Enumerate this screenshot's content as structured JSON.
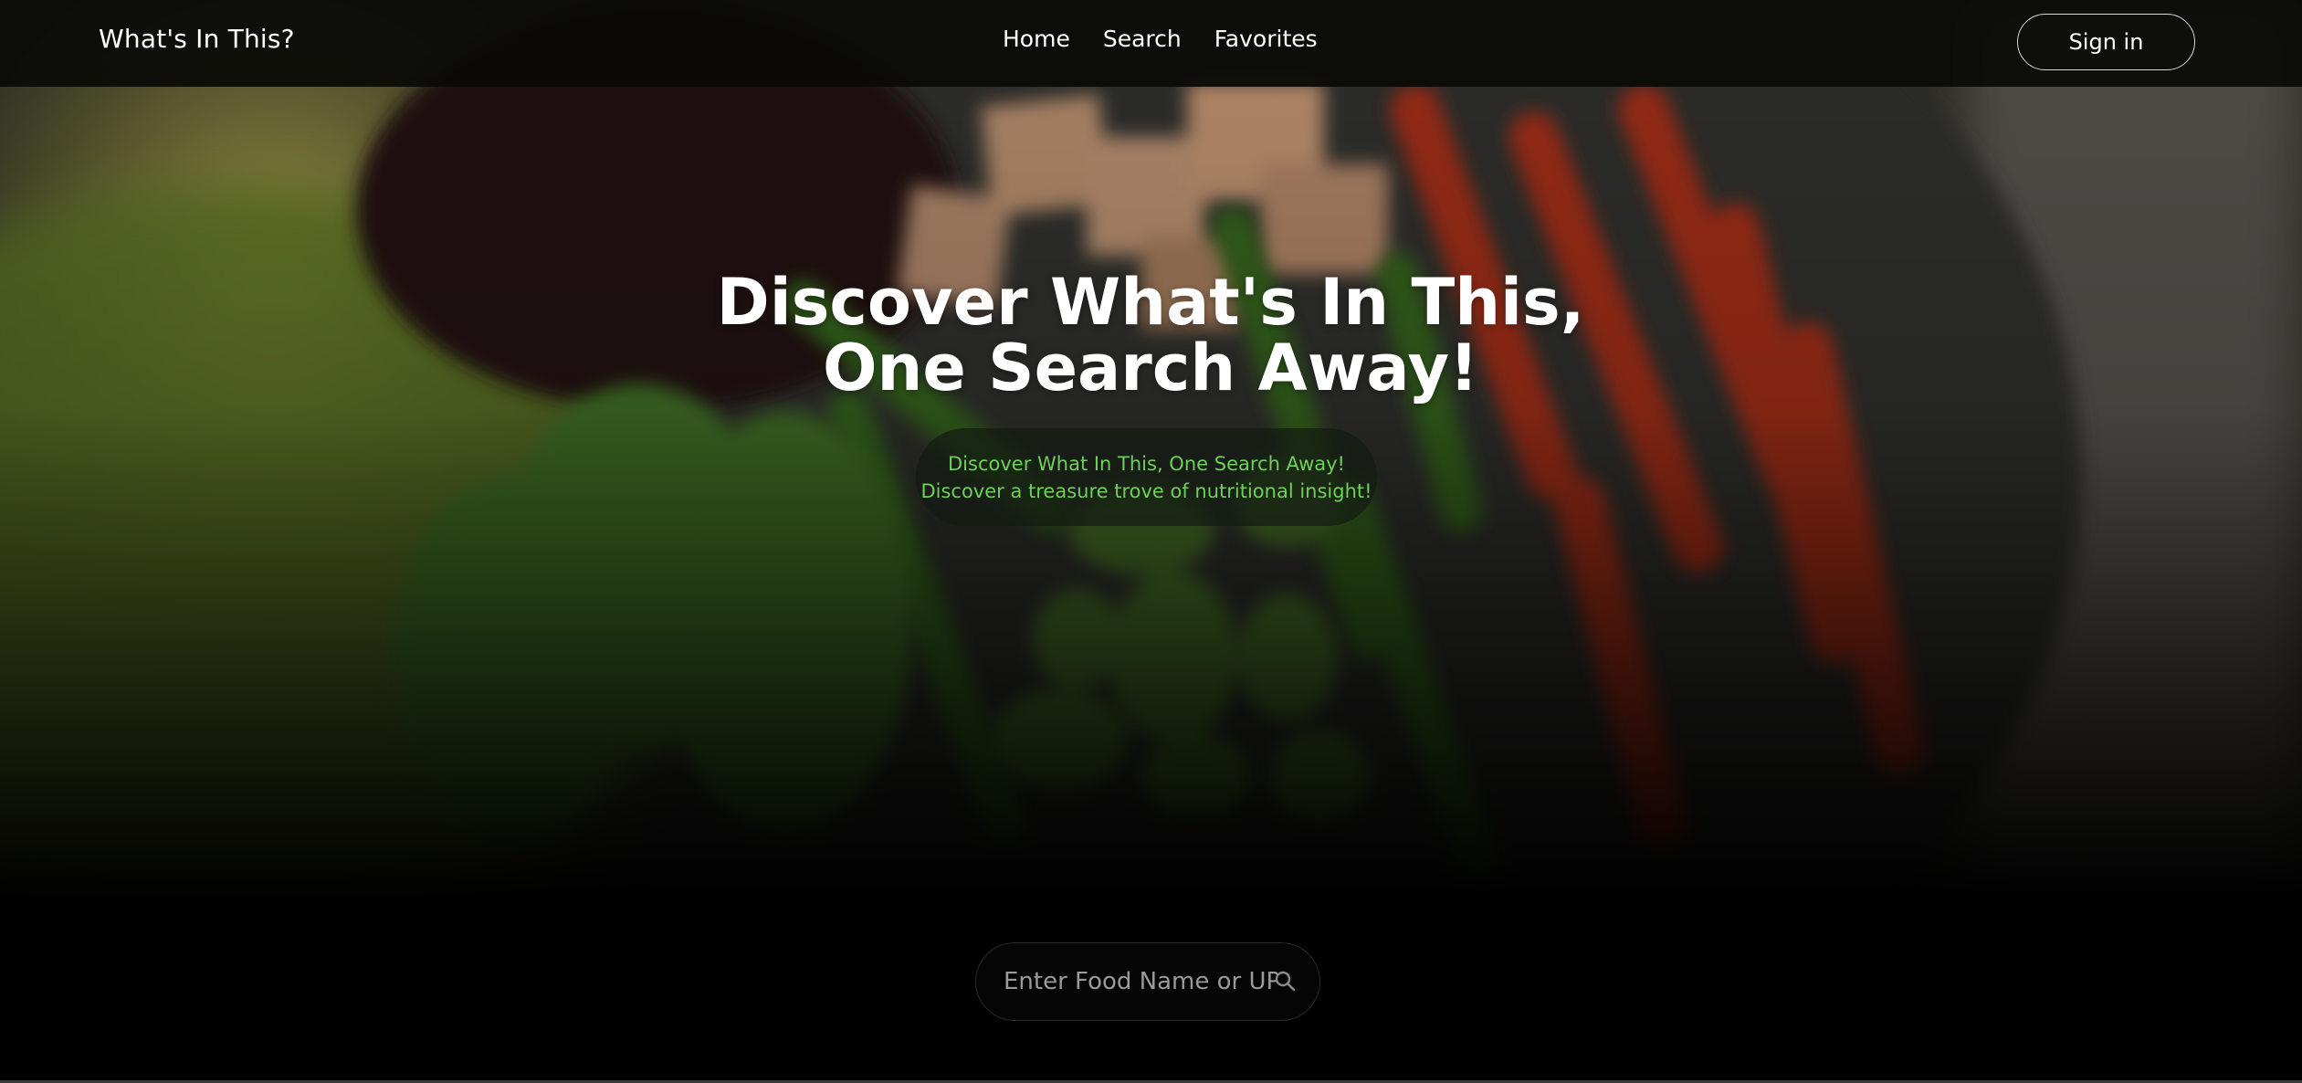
{
  "navbar": {
    "brand": "What's In This?",
    "links": [
      {
        "label": "Home"
      },
      {
        "label": "Search"
      },
      {
        "label": "Favorites"
      }
    ],
    "signin_label": "Sign in"
  },
  "hero": {
    "headline_line1": "Discover What's In This,",
    "headline_line2": "One Search Away!",
    "tagline_line1": "Discover What In This, One Search Away!",
    "tagline_line2": "Discover a treasure trove of nutritional insight!"
  },
  "search": {
    "placeholder": "Enter Food Name or UPC",
    "icon": "search-icon"
  },
  "colors": {
    "tagline_text": "#6ecf5a",
    "background": "#000000"
  }
}
